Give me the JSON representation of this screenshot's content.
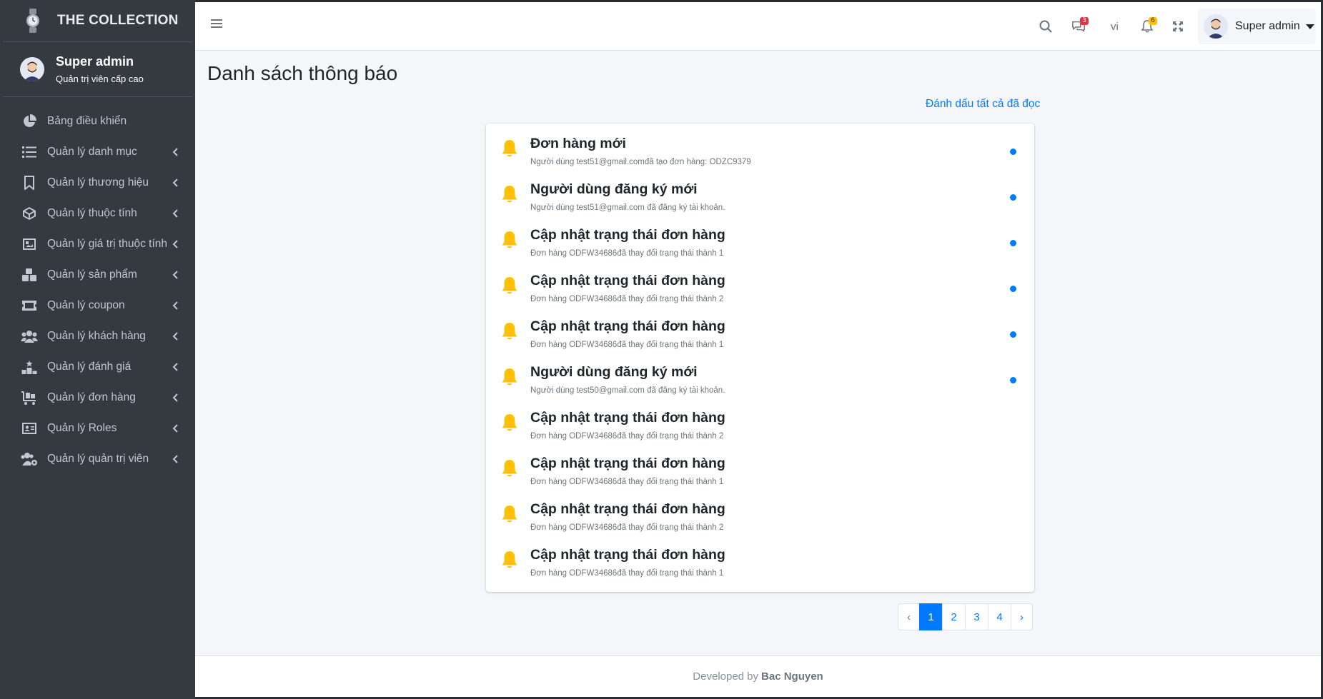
{
  "brand": {
    "name": "THE COLLECTION"
  },
  "user": {
    "name": "Super admin",
    "role": "Quản trị viên cấp cao"
  },
  "sidebar": {
    "items": [
      {
        "label": "Bảng điều khiển",
        "icon": "pie-chart-icon",
        "has_children": false
      },
      {
        "label": "Quản lý danh mục",
        "icon": "list-icon",
        "has_children": true
      },
      {
        "label": "Quản lý thương hiệu",
        "icon": "bookmark-icon",
        "has_children": true
      },
      {
        "label": "Quản lý thuộc tính",
        "icon": "cube-icon",
        "has_children": true
      },
      {
        "label": "Quản lý giá trị thuộc tính",
        "icon": "image-icon",
        "has_children": true
      },
      {
        "label": "Quản lý sản phẩm",
        "icon": "boxes-icon",
        "has_children": true
      },
      {
        "label": "Quản lý coupon",
        "icon": "ticket-icon",
        "has_children": true
      },
      {
        "label": "Quản lý khách hàng",
        "icon": "users-icon",
        "has_children": true
      },
      {
        "label": "Quản lý đánh giá",
        "icon": "ranking-icon",
        "has_children": true
      },
      {
        "label": "Quản lý đơn hàng",
        "icon": "cart-icon",
        "has_children": true
      },
      {
        "label": "Quản lý Roles",
        "icon": "id-card-icon",
        "has_children": true
      },
      {
        "label": "Quản lý quản trị viên",
        "icon": "users-cog-icon",
        "has_children": true
      }
    ]
  },
  "header": {
    "lang": "vi",
    "messages_count": "3",
    "notifications_count": "6",
    "user_name": "Super admin"
  },
  "page": {
    "title": "Danh sách thông báo",
    "mark_all_read": "Đánh dấu tất cả đã đọc"
  },
  "notifications": [
    {
      "title": "Đơn hàng mới",
      "description": "Người dùng test51@gmail.comđã tạo đơn hàng: ODZC9379",
      "unread": true
    },
    {
      "title": "Người dùng đăng ký mới",
      "description": "Người dùng test51@gmail.com đã đăng ký tài khoản.",
      "unread": true
    },
    {
      "title": "Cập nhật trạng thái đơn hàng",
      "description": "Đơn hàng ODFW34686đã thay đổi trạng thái thành 1",
      "unread": true
    },
    {
      "title": "Cập nhật trạng thái đơn hàng",
      "description": "Đơn hàng ODFW34686đã thay đổi trạng thái thành 2",
      "unread": true
    },
    {
      "title": "Cập nhật trạng thái đơn hàng",
      "description": "Đơn hàng ODFW34686đã thay đổi trạng thái thành 1",
      "unread": true
    },
    {
      "title": "Người dùng đăng ký mới",
      "description": "Người dùng test50@gmail.com đã đăng ký tài khoản.",
      "unread": true
    },
    {
      "title": "Cập nhật trạng thái đơn hàng",
      "description": "Đơn hàng ODFW34686đã thay đổi trạng thái thành 2",
      "unread": false
    },
    {
      "title": "Cập nhật trạng thái đơn hàng",
      "description": "Đơn hàng ODFW34686đã thay đổi trạng thái thành 1",
      "unread": false
    },
    {
      "title": "Cập nhật trạng thái đơn hàng",
      "description": "Đơn hàng ODFW34686đã thay đổi trạng thái thành 2",
      "unread": false
    },
    {
      "title": "Cập nhật trạng thái đơn hàng",
      "description": "Đơn hàng ODFW34686đã thay đổi trạng thái thành 1",
      "unread": false
    }
  ],
  "pagination": {
    "prev": "‹",
    "pages": [
      "1",
      "2",
      "3",
      "4"
    ],
    "active": "1",
    "next": "›"
  },
  "footer": {
    "prefix": "Developed by",
    "author": "Bac Nguyen"
  },
  "colors": {
    "sidebar_bg": "#343a40",
    "primary": "#007bff",
    "bell": "#ffc107",
    "badge_red": "#dc3545",
    "badge_yellow": "#ffc107"
  }
}
